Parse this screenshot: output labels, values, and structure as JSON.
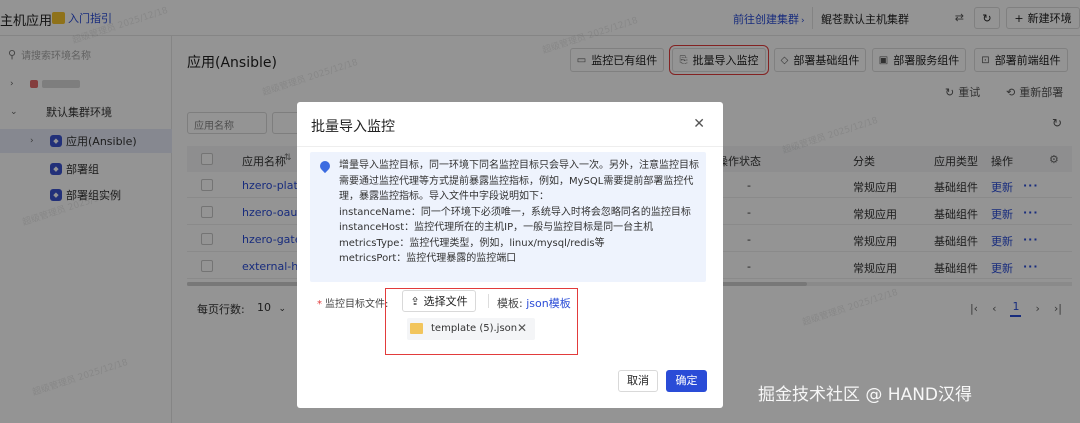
{
  "topbar": {
    "app_title": "主机应用",
    "guide_label": "入门指引",
    "create_cluster_link": "前往创建集群",
    "cluster_name": "鲲苍默认主机集群",
    "new_env_button": "新建环境"
  },
  "sidebar": {
    "search_placeholder": "请搜索环境名称",
    "items": [
      {
        "label": "默认集群环境"
      },
      {
        "label": "应用(Ansible)"
      },
      {
        "label": "部署组"
      },
      {
        "label": "部署组实例"
      }
    ]
  },
  "main": {
    "title": "应用(Ansible)",
    "actions": [
      {
        "label": "监控已有组件"
      },
      {
        "label": "批量导入监控"
      },
      {
        "label": "部署基础组件"
      },
      {
        "label": "部署服务组件"
      },
      {
        "label": "部署前端组件"
      }
    ],
    "retry_label": "重试",
    "redeploy_label": "重新部署",
    "filter_placeholder": "应用名称",
    "table": {
      "headers": [
        "应用名称",
        "操作状态",
        "分类",
        "应用类型",
        "操作"
      ],
      "rows": [
        {
          "name": "hzero-platf",
          "status": "-",
          "category": "常规应用",
          "type": "基础组件",
          "action": "更新"
        },
        {
          "name": "hzero-oauth",
          "status": "-",
          "category": "常规应用",
          "type": "基础组件",
          "action": "更新"
        },
        {
          "name": "hzero-gatew",
          "status": "-",
          "category": "常规应用",
          "type": "基础组件",
          "action": "更新"
        },
        {
          "name": "external-hz",
          "status": "-",
          "category": "常规应用",
          "type": "基础组件",
          "action": "更新"
        }
      ]
    },
    "pager": {
      "rows_label": "每页行数:",
      "page_size": "10",
      "current_page": "1"
    }
  },
  "watermark_text": "超级管理员 2025/12/18",
  "modal": {
    "title": "批量导入监控",
    "info_lines": [
      "增量导入监控目标，同一环境下同名监控目标只会导入一次。另外，注意监控目标",
      "需要通过监控代理等方式提前暴露监控指标，例如，MySQL需要提前部署监控代",
      "理，暴露监控指标。导入文件中字段说明如下：",
      "instanceName：同一个环境下必须唯一，系统导入时将会忽略同名的监控目标",
      "instanceHost：监控代理所在的主机IP，一般与监控目标是同一台主机",
      "metricsType：监控代理类型，例如，linux/mysql/redis等",
      "metricsPort：监控代理暴露的监控端口"
    ],
    "field_label": "监控目标文件:",
    "upload_button": "选择文件",
    "template_label": "模板:",
    "template_link": "json模板",
    "file_name": "template (5).json",
    "cancel_button": "取消",
    "confirm_button": "确定"
  },
  "site_credit": "掘金技术社区 @ HAND汉得",
  "colors": {
    "primary": "#2a4cd7",
    "highlight": "#e23b3b",
    "info_bg": "#eef3fd"
  }
}
